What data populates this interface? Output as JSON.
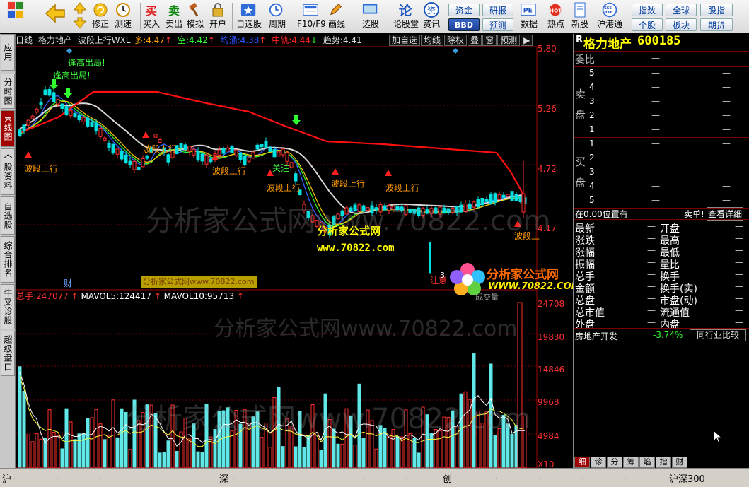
{
  "toolbar": {
    "buttons": [
      {
        "name": "modify-button",
        "label": "修正",
        "icon": "yellow-up-down-arrow-icon"
      },
      {
        "name": "speedtest-button",
        "label": "测速",
        "icon": "clock-icon"
      },
      {
        "name": "buy-button",
        "label": "买入",
        "glyph": "买"
      },
      {
        "name": "sell-button",
        "label": "卖出",
        "glyph": "卖"
      },
      {
        "name": "simulate-button",
        "label": "模拟",
        "icon": "hammer-icon"
      },
      {
        "name": "open-account-button",
        "label": "开户",
        "icon": "lock-icon"
      },
      {
        "name": "watchlist-button",
        "label": "自选股",
        "icon": "star-icon"
      },
      {
        "name": "period-button",
        "label": "周期",
        "icon": "clock-cycle-icon"
      },
      {
        "name": "f10-button",
        "label": "F10/F9",
        "icon": "f10-icon"
      },
      {
        "name": "draw-line-button",
        "label": "画线",
        "icon": "pencil-icon"
      },
      {
        "name": "stock-select-button",
        "label": "选股",
        "icon": "screen-icon"
      },
      {
        "name": "forum-button",
        "label": "论股堂",
        "icon": "forum-icon"
      },
      {
        "name": "news-button",
        "label": "资讯",
        "icon": "news-icon"
      },
      {
        "name": "data-button",
        "label": "数据",
        "icon": "pe-icon"
      },
      {
        "name": "hotspot-button",
        "label": "热点",
        "icon": "hot-icon"
      },
      {
        "name": "new-stock-button",
        "label": "新股",
        "icon": "new-stock-icon"
      },
      {
        "name": "sh-hk-button",
        "label": "沪港通",
        "icon": "sse-hkex-icon"
      }
    ],
    "pe_text": "PE",
    "hot_text": "HOT",
    "sse_text": "SSE HKE",
    "small_buttons": {
      "funds": "资金",
      "research": "研报",
      "bbd": "BBD",
      "forecast": "预测",
      "index": "指数",
      "global": "全球",
      "futures_idx": "股指",
      "individual": "个股",
      "sector": "板块",
      "futures": "期货"
    }
  },
  "left_tabs": [
    {
      "label": "应用",
      "active": false
    },
    {
      "label": "分时图",
      "active": false
    },
    {
      "label": "K线图",
      "active": true
    },
    {
      "label": "个股资料",
      "active": false
    },
    {
      "label": "自选股",
      "active": false
    },
    {
      "label": "综合排名",
      "active": false
    },
    {
      "label": "牛叉诊股",
      "active": false
    },
    {
      "label": "超级盘口",
      "active": false
    }
  ],
  "kline_header": {
    "period": "日线",
    "name": "格力地产",
    "indicator": "波段上行WXL",
    "duo_label": "多:",
    "duo_value": "4.47",
    "kong_label": "空:",
    "kong_value": "4.42",
    "junxian_label": "均涌:",
    "junxian_value": "4.38",
    "zhonggui_label": "中轨:",
    "zhonggui_value": "4.44",
    "trend_label": "趋势:",
    "trend_value": "4.41"
  },
  "chart_buttons": [
    "加自选",
    "均线",
    "除权",
    "叠",
    "窗",
    "预测",
    "▶"
  ],
  "price_axis": [
    "5.80",
    "5.26",
    "4.72",
    "4.17"
  ],
  "volume_axis": [
    "24708",
    "19830",
    "14846",
    "9968",
    "4984",
    "X10"
  ],
  "volume_header": {
    "total_label": "总手:",
    "total_value": "247077",
    "ma5_label": "MAVOL5:",
    "ma5_value": "124417",
    "ma10_label": "MAVOL10:",
    "ma10_value": "95713"
  },
  "annotations": {
    "fenghao_1": "逢高出局!",
    "fenghao_2": "逢高出局!",
    "buy_follow": "关注!",
    "zhuyi": "注意",
    "cai": "财",
    "rise_labels": [
      "波段上行",
      "波段上行",
      "波段上行",
      "波段上行",
      "波段上行",
      "波段上行",
      "波段上"
    ],
    "low_price": "3"
  },
  "watermarks": {
    "main": "分析家公式网www.70822.com",
    "caption": "分析家公式网",
    "url": "www.70822.com",
    "logo_main": "分析家公式网",
    "logo_url": "WWW.70822.COM",
    "bar_caption": "分析家公式网www.70822.com",
    "vol_tag": "成交量"
  },
  "quote_panel": {
    "r_label": "R",
    "stock_name": "格力地产",
    "stock_code": "600185",
    "weibi": "委比",
    "dash": "—",
    "sell_label": [
      "卖",
      "盘"
    ],
    "buy_label": [
      "买",
      "盘"
    ],
    "levels": [
      "5",
      "4",
      "3",
      "2",
      "1"
    ],
    "buy_levels": [
      "1",
      "2",
      "3",
      "4",
      "5"
    ],
    "position_text": "在0.00位置有",
    "sell_order_text": "卖单!",
    "detail_link": "查看详细",
    "stats_left": [
      "最新",
      "涨跌",
      "涨幅",
      "振幅",
      "总手",
      "金额",
      "总盘",
      "总市值",
      "外盘"
    ],
    "stats_right": [
      "开盘",
      "最高",
      "最低",
      "量比",
      "换手",
      "换手(实)",
      "市盘(动)",
      "流通值",
      "内盘"
    ],
    "sector_name": "房地产开发",
    "sector_change": "-3.74%",
    "compare_btn": "同行业比较"
  },
  "bottom_tabs": [
    {
      "label": "细",
      "active": true
    },
    {
      "label": "诊",
      "active": false
    },
    {
      "label": "分",
      "active": false
    },
    {
      "label": "筹",
      "active": false
    },
    {
      "label": "焰",
      "active": false
    },
    {
      "label": "指",
      "active": false
    },
    {
      "label": "财",
      "active": false
    }
  ],
  "status_bar": {
    "sh": "沪",
    "sz": "深",
    "cy": "创",
    "index_name": "沪深300",
    "colors": {
      "up": "#ff3030",
      "down": "#00c000",
      "cyan": "#00ffff",
      "red_line": "#ff0000"
    }
  }
}
